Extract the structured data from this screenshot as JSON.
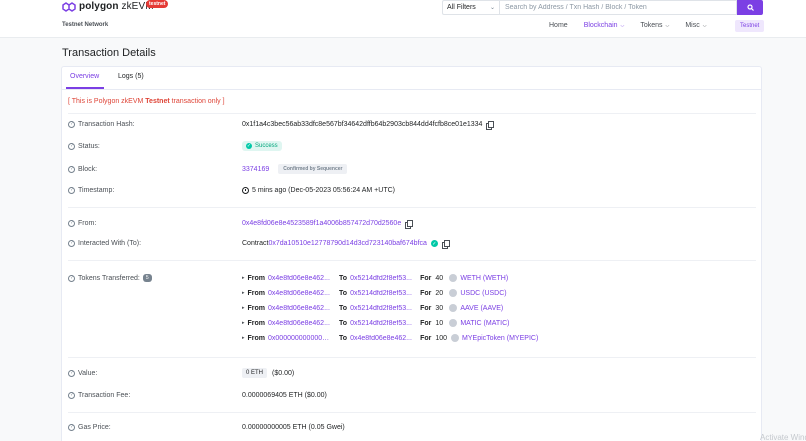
{
  "header": {
    "logo_text_bold": "polygon",
    "logo_text": " zkEVM",
    "testnet_badge": "testnet",
    "network_label": "Testnet Network",
    "filter_selected": "All Filters",
    "search_placeholder": "Search by Address / Txn Hash / Block / Token",
    "nav": {
      "home": "Home",
      "blockchain": "Blockchain",
      "tokens": "Tokens",
      "misc": "Misc",
      "network_button": "Testnet"
    }
  },
  "page_title": "Transaction Details",
  "tabs": {
    "overview": "Overview",
    "logs": "Logs (5)"
  },
  "notice": {
    "open": "[ This is Polygon zkEVM ",
    "bold": "Testnet",
    "close": " transaction only ]"
  },
  "details": {
    "tx_hash_label": "Transaction Hash:",
    "tx_hash": "0x1f1a4c3bec56ab33dfc8e567bf34642dffb64b2903cb844dd4fcfb8ce01e1334",
    "status_label": "Status:",
    "status": "Success",
    "block_label": "Block:",
    "block": "3374169",
    "block_confirmation": "Confirmed by Sequencer",
    "timestamp_label": "Timestamp:",
    "timestamp": "5 mins ago (Dec-05-2023 05:56:24 AM +UTC)",
    "from_label": "From:",
    "from": "0x4e8fd06e8e4523589f1a4006b857472d70d2560e",
    "interacted_label": "Interacted With (To):",
    "interacted_prefix": "Contract ",
    "interacted": "0x7da10510e12778790d14d3cd723140baf674bfca",
    "tokens_label": "Tokens Transferred:",
    "tokens_count": "5",
    "value_label": "Value:",
    "value_eth": "0 ETH",
    "value_usd": "($0.00)",
    "fee_label": "Transaction Fee:",
    "fee": "0.0000069405 ETH ($0.00)",
    "gas_label": "Gas Price:",
    "gas": "0.00000000005 ETH (0.05 Gwei)"
  },
  "transfers_labels": {
    "from": "From",
    "to": "To",
    "for": "For"
  },
  "transfers": [
    {
      "from": "0x4e8fd06e8e462...",
      "to": "0x5214dfd2f8ef53...",
      "amount": "40",
      "token": "WETH (WETH)"
    },
    {
      "from": "0x4e8fd06e8e462...",
      "to": "0x5214dfd2f8ef53...",
      "amount": "20",
      "token": "USDC (USDC)"
    },
    {
      "from": "0x4e8fd06e8e462...",
      "to": "0x5214dfd2f8ef53...",
      "amount": "30",
      "token": "AAVE (AAVE)"
    },
    {
      "from": "0x4e8fd06e8e462...",
      "to": "0x5214dfd2f8ef53...",
      "amount": "10",
      "token": "MATIC (MATIC)"
    },
    {
      "from": "0x000000000000000...",
      "to": "0x4e8fd06e8e462...",
      "amount": "100",
      "token": "MYEpicToken (MYEPIC)"
    }
  ],
  "watermark": "Activate Wind",
  "colors": {
    "accent": "#7b3fe4",
    "success": "#00c9a7",
    "notice": "#de4437"
  }
}
